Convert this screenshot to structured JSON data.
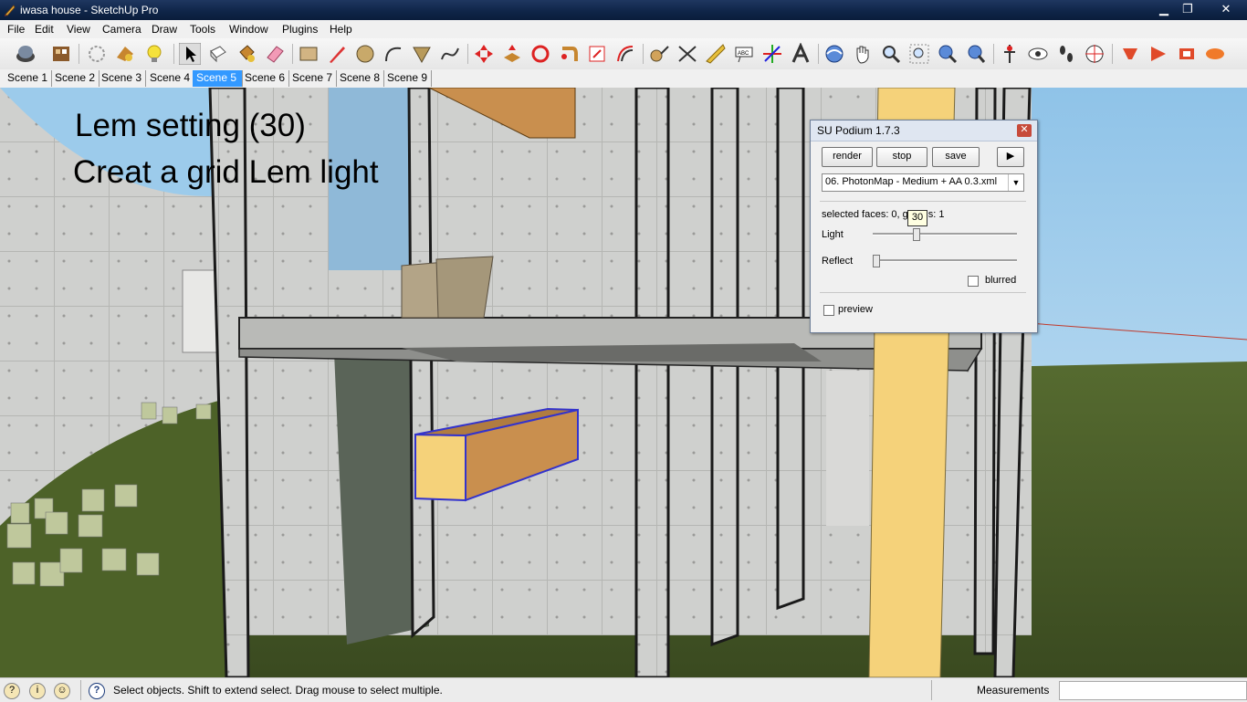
{
  "window": {
    "title": "iwasa house - SketchUp Pro",
    "controls": [
      "minimize",
      "maximize",
      "close"
    ]
  },
  "menu": [
    "File",
    "Edit",
    "View",
    "Camera",
    "Draw",
    "Tools",
    "Window",
    "Plugins",
    "Help"
  ],
  "scenes": {
    "tabs": [
      "Scene 1",
      "Scene 2",
      "Scene 3",
      "Scene 4",
      "Scene 5",
      "Scene 6",
      "Scene 7",
      "Scene 8",
      "Scene 9"
    ],
    "active": "Scene 5"
  },
  "overlay": {
    "line1": "Lem setting (30)",
    "line2": "Creat a grid Lem light"
  },
  "podium": {
    "title": "SU Podium 1.7.3",
    "render_label": "render",
    "stop_label": "stop",
    "save_label": "save",
    "preset": "06. PhotonMap - Medium + AA 0.3.xml",
    "selected_faces_prefix": "selected faces: 0, g",
    "selected_faces_suffix": "s: 1",
    "light_label": "Light",
    "reflect_label": "Reflect",
    "blurred_label": "blurred",
    "preview_label": "preview",
    "tooltip_value": "30",
    "light_value": 30,
    "reflect_value": 0,
    "blurred_checked": false,
    "preview_checked": false
  },
  "status": {
    "hint": "Select objects. Shift to extend select. Drag mouse to select multiple.",
    "measurements_label": "Measurements",
    "measurements_value": ""
  },
  "colors": {
    "active_tab": "#3399ff",
    "selection": "#3333cc",
    "column_yellow": "#f5d27a",
    "sky": "#a9d3ef",
    "grass": "#4a5e2a"
  }
}
